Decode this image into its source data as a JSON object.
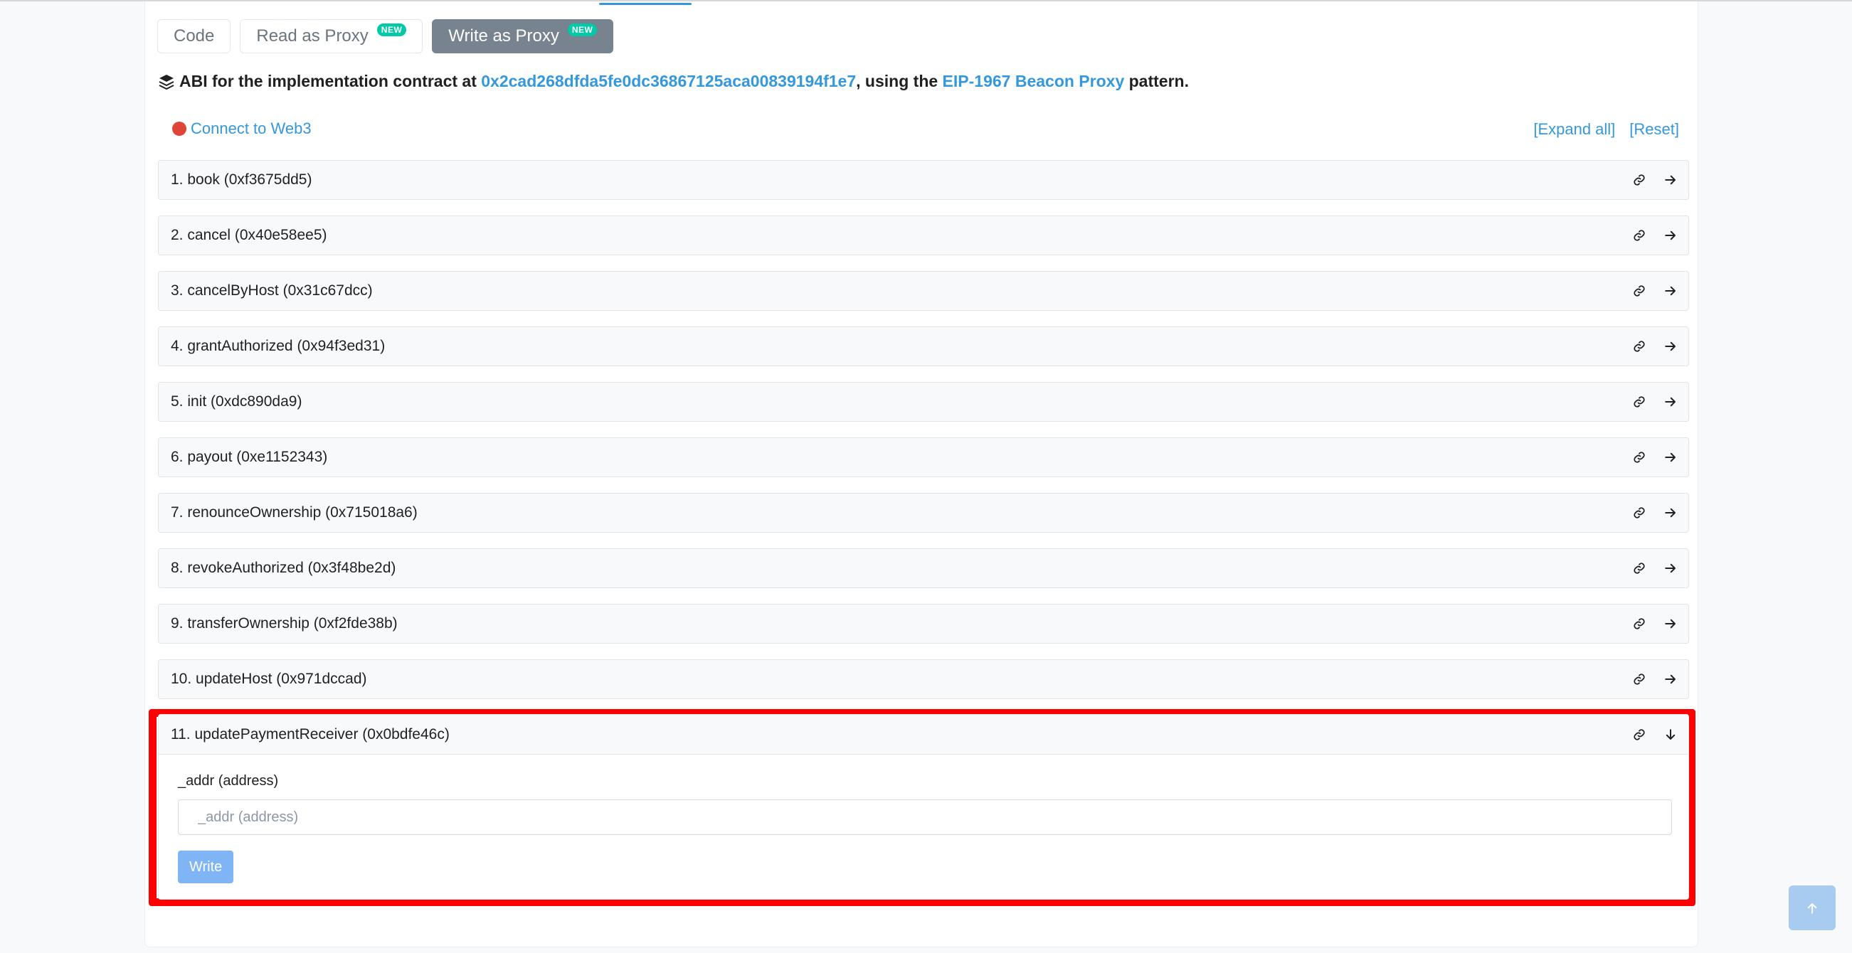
{
  "tabs": [
    {
      "label": "Code",
      "badge": ""
    },
    {
      "label": "Read as Proxy",
      "badge": "NEW"
    },
    {
      "label": "Write as Proxy",
      "badge": "NEW"
    }
  ],
  "abi": {
    "prefix": "ABI for the implementation contract at ",
    "address": "0x2cad268dfda5fe0dc36867125aca00839194f1e7",
    "middle": ", using the ",
    "pattern_link": "EIP-1967 Beacon Proxy",
    "suffix": " pattern."
  },
  "connect_label": "Connect to Web3",
  "controls": {
    "expand_all": "[Expand all]",
    "reset": "[Reset]"
  },
  "functions": [
    "1. book (0xf3675dd5)",
    "2. cancel (0x40e58ee5)",
    "3. cancelByHost (0x31c67dcc)",
    "4. grantAuthorized (0x94f3ed31)",
    "5. init (0xdc890da9)",
    "6. payout (0xe1152343)",
    "7. renounceOwnership (0x715018a6)",
    "8. revokeAuthorized (0x3f48be2d)",
    "9. transferOwnership (0xf2fde38b)",
    "10. updateHost (0x971dccad)"
  ],
  "expanded_function": {
    "title": "11. updatePaymentReceiver (0x0bdfe46c)",
    "param_label": "_addr (address)",
    "param_placeholder": "_addr (address)",
    "write_label": "Write"
  },
  "colors": {
    "accent": "#3498db",
    "highlight": "#ff0000",
    "status_dot": "#de4437",
    "badge": "#00c9a7"
  }
}
